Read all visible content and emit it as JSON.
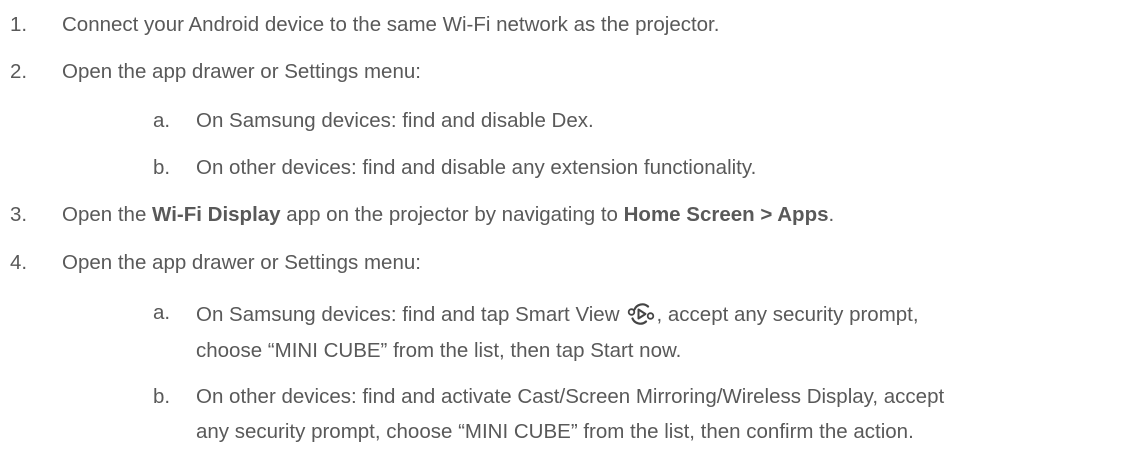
{
  "steps": [
    {
      "number": "1.",
      "text": "Connect your Android device to the same Wi-Fi network as the projector."
    },
    {
      "number": "2.",
      "text": "Open the app drawer or Settings menu:",
      "substeps": [
        {
          "letter": "a.",
          "text": "On Samsung devices: find and disable Dex."
        },
        {
          "letter": "b.",
          "text": "On other devices: find and disable any extension functionality."
        }
      ]
    },
    {
      "number": "3.",
      "text_before": "Open the ",
      "bold_1": "Wi-Fi Display",
      "text_middle": " app on the projector by navigating to ",
      "bold_2": "Home Screen > Apps",
      "text_after": "."
    },
    {
      "number": "4.",
      "text": "Open the app drawer or Settings menu:",
      "substeps": [
        {
          "letter": "a.",
          "text_before_icon": "On Samsung devices: find and tap Smart View",
          "icon": "smart-view-icon",
          "text_after_icon": ", accept any security prompt,",
          "continuation": "choose “MINI CUBE” from the list, then tap Start now."
        },
        {
          "letter": "b.",
          "text": "On other devices: find and activate Cast/Screen Mirroring/Wireless Display, accept",
          "continuation": "any security prompt, choose “MINI CUBE” from the list, then confirm the action."
        }
      ]
    }
  ]
}
